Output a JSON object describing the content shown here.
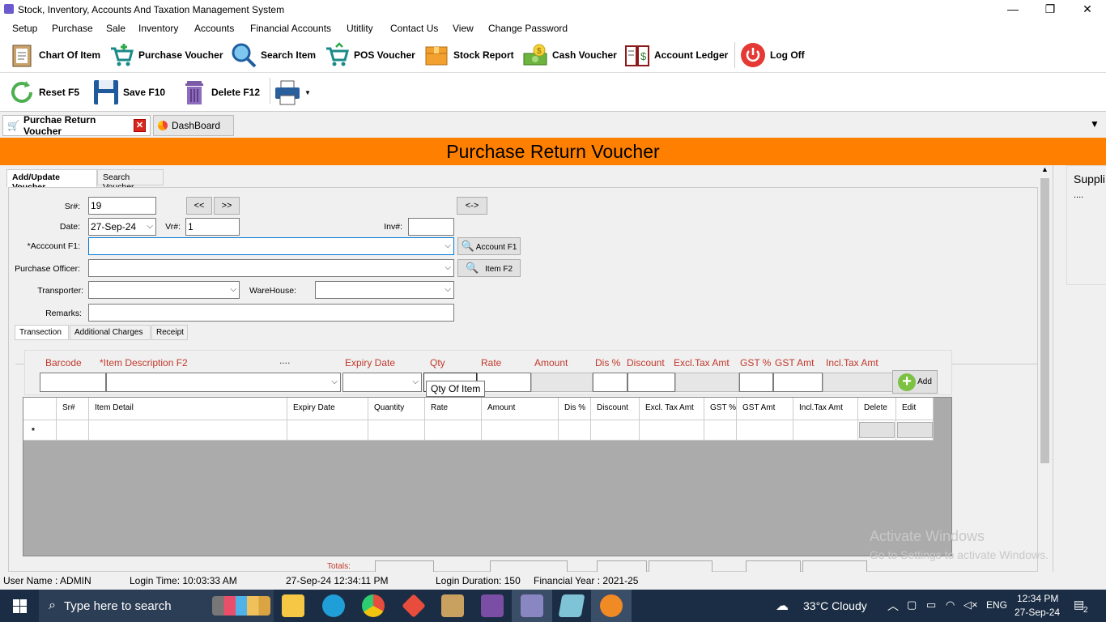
{
  "window": {
    "title": "Stock, Inventory, Accounts And Taxation Management System"
  },
  "menu": [
    "Setup",
    "Purchase",
    "Sale",
    "Inventory",
    "Accounts",
    "Financial Accounts",
    "Utitlity",
    "Contact Us",
    "View",
    "Change Password"
  ],
  "toolbar1": {
    "chart_of_item": "Chart Of Item",
    "purchase_voucher": "Purchase Voucher",
    "search_item": "Search Item",
    "pos_voucher": "POS Voucher",
    "stock_report": "Stock Report",
    "cash_voucher": "Cash Voucher",
    "account_ledger": "Account Ledger",
    "log_off": "Log Off"
  },
  "toolbar2": {
    "reset": "Reset F5",
    "save": "Save F10",
    "delete": "Delete F12"
  },
  "doctabs": {
    "active": "Purchae Return Voucher",
    "dashboard": "DashBoard"
  },
  "banner": "Purchase Return Voucher",
  "formtabs": {
    "add_update": "Add/Update Voucher",
    "search": "Search Voucher"
  },
  "form": {
    "sr_label": "Sr#:",
    "sr_value": "19",
    "prev": "<<",
    "next": ">>",
    "swap": "<->",
    "date_label": "Date:",
    "date_value": "27-Sep-24",
    "vr_label": "Vr#:",
    "vr_value": "1",
    "inv_label": "Inv#:",
    "inv_value": "",
    "account_label": "*Acccount F1:",
    "account_btn": "Account F1",
    "officer_label": "Purchase Officer:",
    "item_btn": "Item F2",
    "transporter_label": "Transporter:",
    "warehouse_label": "WareHouse:",
    "remarks_label": "Remarks:"
  },
  "subtabs": [
    "Transection",
    "Additional Charges",
    "Receipt"
  ],
  "entry": {
    "barcode": "Barcode",
    "item_desc": "*Item Description F2",
    "dots": "....",
    "expiry": "Expiry Date",
    "qty": "Qty",
    "rate": "Rate",
    "amount": "Amount",
    "dis_pct": "Dis %",
    "discount": "Discount",
    "excl_tax": "Excl.Tax Amt",
    "gst_pct": "GST %",
    "gst_amt": "GST Amt",
    "incl_tax": "Incl.Tax Amt",
    "add": "Add"
  },
  "tooltip": "Qty Of Item",
  "grid": {
    "headers": [
      "",
      "Sr#",
      "Item Detail",
      "Expiry Date",
      "Quantity",
      "Rate",
      "Amount",
      "Dis %",
      "Discount",
      "Excl. Tax Amt",
      "GST %",
      "GST Amt",
      "Incl.Tax Amt",
      "Delete",
      "Edit"
    ],
    "new_row_marker": "*"
  },
  "totals_label": "Totals:",
  "right_panel": {
    "title": "Suppli",
    "dots": "...."
  },
  "watermark": {
    "line1": "Activate Windows",
    "line2": "Go to Settings to activate Windows."
  },
  "status": {
    "user": "User Name : ADMIN",
    "login_time": "Login Time:   10:03:33 AM",
    "datetime": "27-Sep-24 12:34:11 PM",
    "duration": "Login Duration: 150",
    "fin_year": "Financial Year : 2021-25"
  },
  "taskbar": {
    "search_placeholder": "Type here to search",
    "weather": "33°C  Cloudy",
    "lang": "ENG",
    "time": "12:34 PM",
    "date": "27-Sep-24",
    "notif_count": "2"
  },
  "colors": {
    "banner": "#ff8000",
    "header_text": "#c0392b",
    "taskbar": "#1b2d44"
  }
}
